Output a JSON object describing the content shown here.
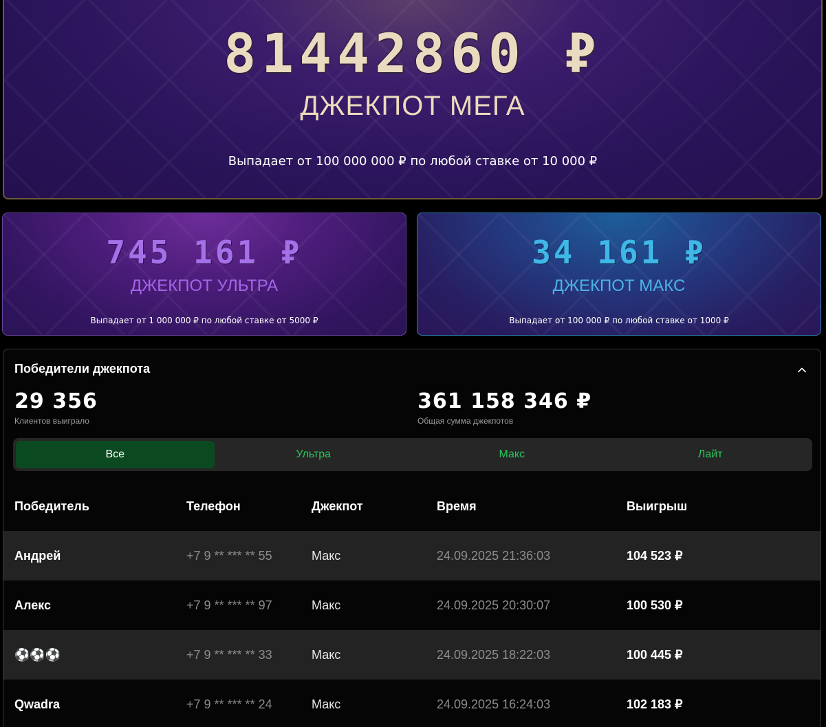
{
  "jackpots": {
    "mega": {
      "amount": "81442860 ₽",
      "title": "ДЖЕКПОТ МЕГА",
      "description": "Выпадает от 100 000 000 ₽ по любой ставке от 10 000 ₽",
      "color": "#eadbc0"
    },
    "ultra": {
      "amount": "745 161 ₽",
      "title": "ДЖЕКПОТ УЛЬТРА",
      "description": "Выпадает от 1 000 000 ₽ по любой ставке от 5000 ₽",
      "color": "#a570e8"
    },
    "maxi": {
      "amount": "34 161 ₽",
      "title": "ДЖЕКПОТ МАКС",
      "description": "Выпадает от 100 000 ₽ по любой ставке от 1000 ₽",
      "color": "#3fb8e8"
    }
  },
  "winners": {
    "heading": "Победители джекпота",
    "clients_count": "29 356",
    "clients_label": "Клиентов выиграло",
    "total_sum": "361 158 346 ₽",
    "total_label": "Общая сумма джекпотов",
    "tabs": [
      {
        "label": "Все",
        "active": true
      },
      {
        "label": "Ультра",
        "active": false
      },
      {
        "label": "Макс",
        "active": false
      },
      {
        "label": "Лайт",
        "active": false
      }
    ],
    "columns": [
      "Победитель",
      "Телефон",
      "Джекпот",
      "Время",
      "Выигрыш"
    ],
    "rows": [
      {
        "name": "Андрей",
        "phone": "+7 9 ** *** ** 55",
        "jackpot": "Макс",
        "time": "24.09.2025 21:36:03",
        "win": "104 523 ₽"
      },
      {
        "name": "Алекс",
        "phone": "+7 9 ** *** ** 97",
        "jackpot": "Макс",
        "time": "24.09.2025 20:30:07",
        "win": "100 530 ₽"
      },
      {
        "name": "⚽⚽⚽",
        "phone": "+7 9 ** *** ** 33",
        "jackpot": "Макс",
        "time": "24.09.2025 18:22:03",
        "win": "100 445 ₽"
      },
      {
        "name": "Qwadra",
        "phone": "+7 9 ** *** ** 24",
        "jackpot": "Макс",
        "time": "24.09.2025 16:24:03",
        "win": "102 183 ₽"
      }
    ],
    "accent_color": "#2bc45a",
    "collapse_icon": "chevron-up-icon"
  }
}
